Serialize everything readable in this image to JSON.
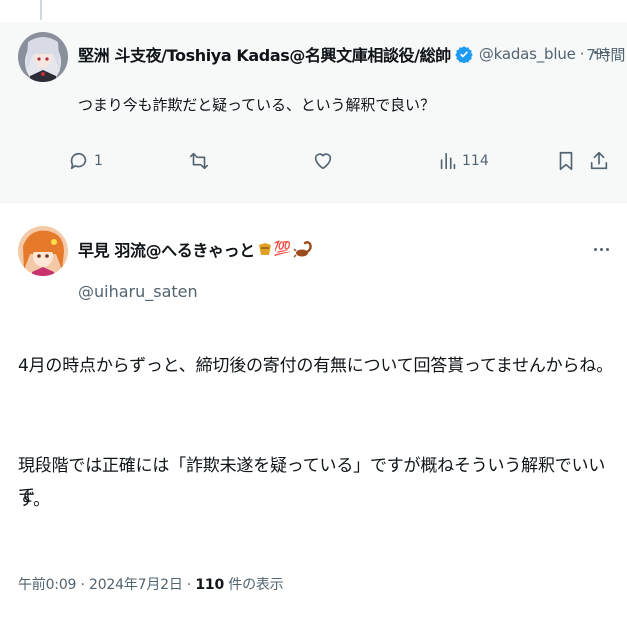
{
  "reply": {
    "author_name": "堅洲 斗支夜/Toshiya Kadas@名興文庫相談役/総帥",
    "verified": true,
    "handle": "@kadas_blue",
    "separator": "·",
    "time": "7時間",
    "text": "つまり今も詐欺だと疑っている、という解釈で良い？",
    "actions": {
      "reply_count": "1",
      "views_count": "114"
    }
  },
  "main_tweet": {
    "author_name": "早見 羽流@へるきゃっと",
    "emoji_suffix": "💯",
    "handle": "@uiharu_saten",
    "paragraph_1": "4月の時点からずっと、締切後の寄付の有無について回答貰ってませんからね。",
    "paragraph_2_line_1": "現段階では正確には「詐欺未遂を疑っている」ですが概ねそういう解釈でいいで",
    "paragraph_2_line_2": "す。",
    "timestamp": "午前0:09 · 2024年7月2日 · ",
    "view_count": "110",
    "view_label": " 件の表示"
  },
  "colors": {
    "text": "#0f1419",
    "secondary": "#536471",
    "verified_blue": "#1d9bf0",
    "reply_bg": "#f7f9f9"
  },
  "icons": [
    "reply-icon",
    "retweet-icon",
    "like-icon",
    "views-icon",
    "bookmark-icon",
    "share-icon",
    "more-icon",
    "verified-badge-icon"
  ]
}
